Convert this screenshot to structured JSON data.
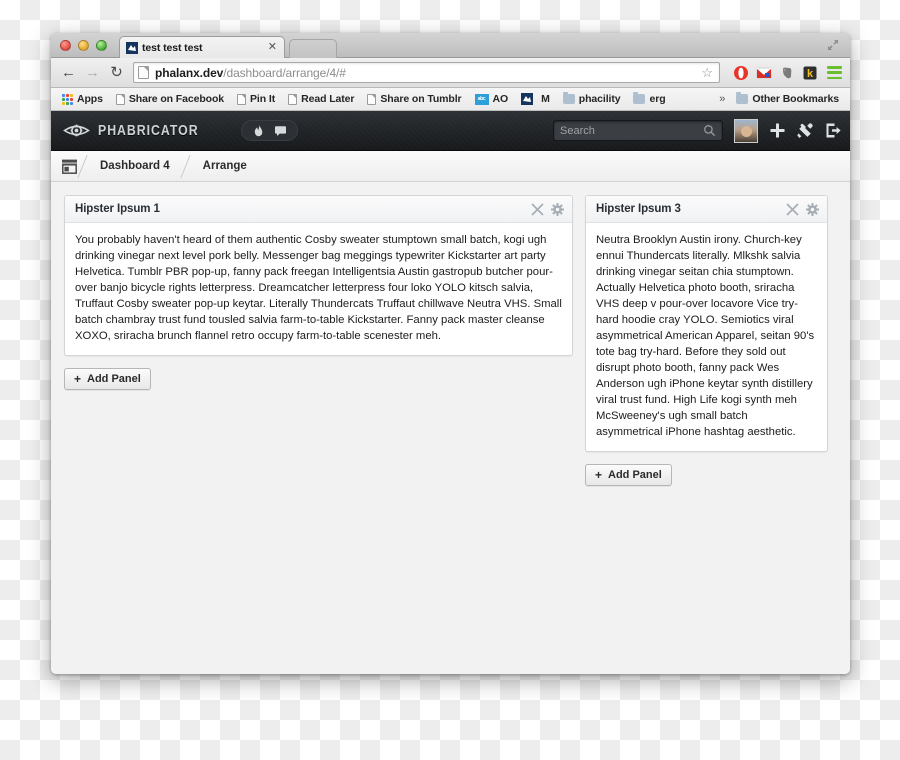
{
  "window": {
    "traffic_lights": [
      "close",
      "minimize",
      "zoom"
    ],
    "expand_icon": "fullscreen-arrows-icon"
  },
  "tab_strip": {
    "tabs": [
      {
        "title": "test test test",
        "favicon": "phabricator-favicon",
        "close_label": "✕"
      }
    ],
    "new_tab_label": ""
  },
  "nav": {
    "back_label": "←",
    "forward_label": "→",
    "reload_label": "↻",
    "url_bold": "phalanx.dev",
    "url_rest": "/dashboard/arrange/4/#",
    "url_full": "phalanx.dev/dashboard/arrange/4/#",
    "star_label": "☆",
    "extensions": [
      {
        "name": "opera-extension-icon",
        "color": "#e8342a"
      },
      {
        "name": "gmail-icon",
        "color": "#d93025"
      },
      {
        "name": "evernote-icon",
        "color": "#6b6b6b"
      },
      {
        "name": "kippt-icon",
        "color": "#e8b324",
        "letter": "k"
      },
      {
        "name": "chrome-menu-icon",
        "color": "#6abf2e"
      }
    ]
  },
  "bookmarks": {
    "items": [
      {
        "label": "Apps",
        "icon": "apps-grid-icon"
      },
      {
        "label": "Share on Facebook",
        "icon": "page-icon"
      },
      {
        "label": "Pin It",
        "icon": "page-icon"
      },
      {
        "label": "Read Later",
        "icon": "page-icon"
      },
      {
        "label": "Share on Tumblr",
        "icon": "page-icon"
      },
      {
        "label": "AO",
        "icon": "ao-icon"
      },
      {
        "label": "M",
        "icon": "phabricator-favicon"
      },
      {
        "label": "phacility",
        "icon": "folder-icon"
      },
      {
        "label": "erg",
        "icon": "folder-icon"
      }
    ],
    "overflow_label": "»",
    "other_bookmarks_label": "Other Bookmarks"
  },
  "phabricator": {
    "wordmark": "PHABRICATOR",
    "logo_icon": "eye-gear-icon",
    "pills": [
      {
        "name": "flame-icon"
      },
      {
        "name": "chat-bubble-icon"
      }
    ],
    "search": {
      "placeholder": "Search",
      "value": "",
      "icon": "search-icon"
    },
    "avatar_name": "user-avatar",
    "actions": [
      {
        "name": "plus-icon"
      },
      {
        "name": "wrench-icon"
      },
      {
        "name": "logout-icon"
      }
    ]
  },
  "breadcrumb": {
    "home_icon": "applications-home-icon",
    "items": [
      {
        "label": "Dashboard 4"
      },
      {
        "label": "Arrange"
      }
    ]
  },
  "dashboard": {
    "columns": [
      {
        "id": "left",
        "panels": [
          {
            "title": "Hipster Ipsum 1",
            "close_icon": "close-icon",
            "settings_icon": "gear-icon",
            "body": "You probably haven't heard of them authentic Cosby sweater stumptown small batch, kogi ugh drinking vinegar next level pork belly. Messenger bag meggings typewriter Kickstarter art party Helvetica. Tumblr PBR pop-up, fanny pack freegan Intelligentsia Austin gastropub butcher pour-over banjo bicycle rights letterpress. Dreamcatcher letterpress four loko YOLO kitsch salvia, Truffaut Cosby sweater pop-up keytar. Literally Thundercats Truffaut chillwave Neutra VHS. Small batch chambray trust fund tousled salvia farm-to-table Kickstarter. Fanny pack master cleanse XOXO, sriracha brunch flannel retro occupy farm-to-table scenester meh."
          }
        ],
        "add_panel_label": "Add Panel",
        "add_panel_plus": "+"
      },
      {
        "id": "right",
        "panels": [
          {
            "title": "Hipster Ipsum 3",
            "close_icon": "close-icon",
            "settings_icon": "gear-icon",
            "body": "Neutra Brooklyn Austin irony. Church-key ennui Thundercats literally. Mlkshk salvia drinking vinegar seitan chia stumptown. Actually Helvetica photo booth, sriracha VHS deep v pour-over locavore Vice try-hard hoodie cray YOLO. Semiotics viral asymmetrical American Apparel, seitan 90's tote bag try-hard. Before they sold out disrupt photo booth, fanny pack Wes Anderson ugh iPhone keytar synth distillery viral trust fund. High Life kogi synth meh McSweeney's ugh small batch asymmetrical iPhone hashtag aesthetic."
          }
        ],
        "add_panel_label": "Add Panel",
        "add_panel_plus": "+"
      }
    ]
  },
  "colors": {
    "header_dark": "#202326",
    "page_bg": "#f2f2f2",
    "panel_border": "#d3d6d9",
    "accent_green": "#6abf2e"
  }
}
